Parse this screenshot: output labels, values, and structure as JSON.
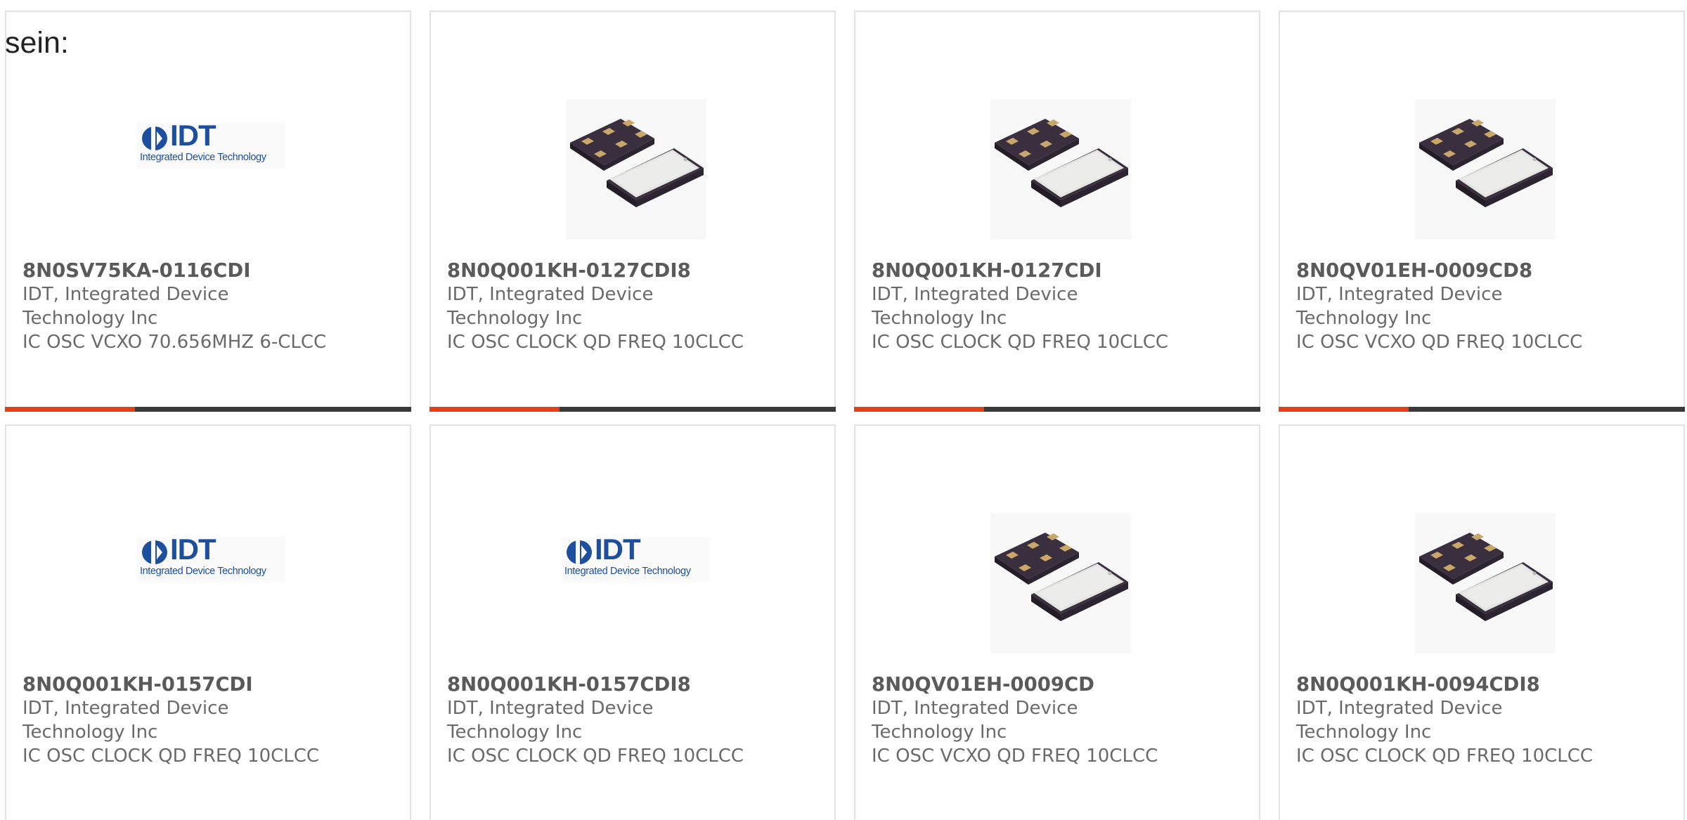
{
  "prefix_text": "sein:",
  "colors": {
    "accent": "#e2401a",
    "track": "#3a3a3a",
    "card_border": "#e2e2e2",
    "part_text": "#5a5a5a",
    "body_text": "#6a6a6a",
    "logo_blue": "#1d4f9e"
  },
  "logo": {
    "word": "IDT",
    "tagline": "Integrated Device Technology"
  },
  "products": [
    {
      "part_number": "8N0SV75KA-0116CDI",
      "manufacturer": "IDT, Integrated Device Technology Inc",
      "description": "IC OSC VCXO 70.656MHZ 6-CLCC",
      "image": "idt-logo",
      "progress": 0.32
    },
    {
      "part_number": "8N0Q001KH-0127CDI8",
      "manufacturer": "IDT, Integrated Device Technology Inc",
      "description": "IC OSC CLOCK QD FREQ 10CLCC",
      "image": "oscillator-chip-photo",
      "progress": 0.32
    },
    {
      "part_number": "8N0Q001KH-0127CDI",
      "manufacturer": "IDT, Integrated Device Technology Inc",
      "description": "IC OSC CLOCK QD FREQ 10CLCC",
      "image": "oscillator-chip-photo",
      "progress": 0.32
    },
    {
      "part_number": "8N0QV01EH-0009CD8",
      "manufacturer": "IDT, Integrated Device Technology Inc",
      "description": "IC OSC VCXO QD FREQ 10CLCC",
      "image": "oscillator-chip-photo",
      "progress": 0.32
    },
    {
      "part_number": "8N0Q001KH-0157CDI",
      "manufacturer": "IDT, Integrated Device Technology Inc",
      "description": "IC OSC CLOCK QD FREQ 10CLCC",
      "image": "idt-logo"
    },
    {
      "part_number": "8N0Q001KH-0157CDI8",
      "manufacturer": "IDT, Integrated Device Technology Inc",
      "description": "IC OSC CLOCK QD FREQ 10CLCC",
      "image": "idt-logo"
    },
    {
      "part_number": "8N0QV01EH-0009CD",
      "manufacturer": "IDT, Integrated Device Technology Inc",
      "description": "IC OSC VCXO QD FREQ 10CLCC",
      "image": "oscillator-chip-photo"
    },
    {
      "part_number": "8N0Q001KH-0094CDI8",
      "manufacturer": "IDT, Integrated Device Technology Inc",
      "description": "IC OSC CLOCK QD FREQ 10CLCC",
      "image": "oscillator-chip-photo"
    }
  ]
}
